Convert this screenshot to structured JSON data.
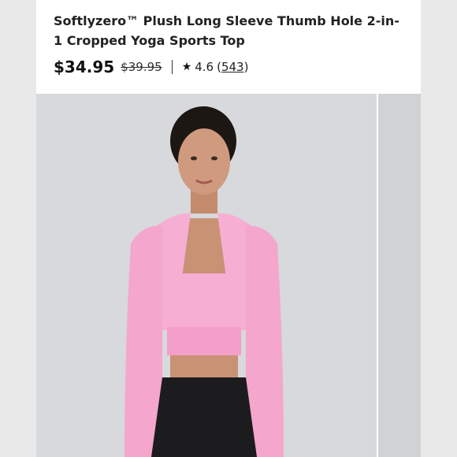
{
  "product": {
    "title": "Softlyzero™ Plush Long Sleeve Thumb Hole 2-in-1 Cropped Yoga Sports Top",
    "price": "$34.95",
    "original_price": "$39.95",
    "separator": "|",
    "rating": "4.6",
    "review_count": "543",
    "review_open": "(",
    "review_close": ")"
  },
  "colors": {
    "top": "#f7aed3",
    "skin": "#c99275",
    "skirt": "#1c1c1e",
    "background": "#d7d9dc"
  },
  "icons": {
    "rating": "star-icon"
  }
}
